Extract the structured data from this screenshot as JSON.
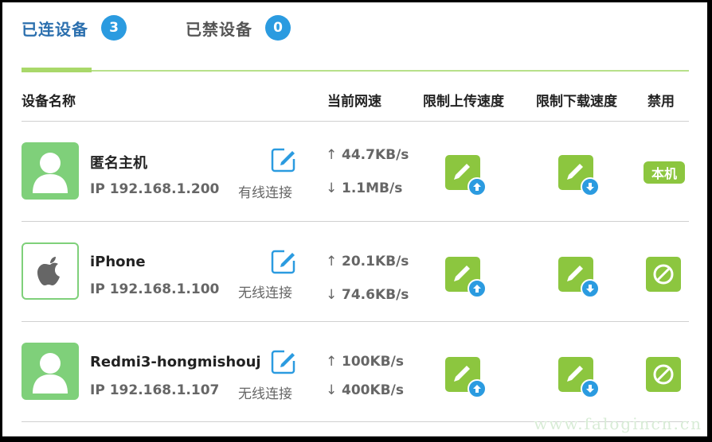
{
  "tabs": [
    {
      "label": "已连设备",
      "count": "3"
    },
    {
      "label": "已禁设备",
      "count": "0"
    }
  ],
  "columns": {
    "name": "设备名称",
    "speed": "当前网速",
    "upload_limit": "限制上传速度",
    "download_limit": "限制下载速度",
    "ban": "禁用"
  },
  "devices": [
    {
      "name": "匿名主机",
      "ip": "IP 192.168.1.200",
      "connection": "有线连接",
      "up": "44.7KB/s",
      "down": "1.1MB/s",
      "avatar": "person-icon",
      "action": "本机"
    },
    {
      "name": "iPhone",
      "ip": "IP 192.168.1.100",
      "connection": "无线连接",
      "up": "20.1KB/s",
      "down": "74.6KB/s",
      "avatar": "apple-icon",
      "action": ""
    },
    {
      "name": "Redmi3-hongmishouj",
      "ip": "IP 192.168.1.107",
      "connection": "无线连接",
      "up": "100KB/s",
      "down": "400KB/s",
      "avatar": "person-icon",
      "action": ""
    }
  ],
  "watermark": "www.falogincn.cn",
  "colors": {
    "accent_green": "#8cc63f",
    "accent_blue": "#2b9be0",
    "tab_active": "#2b6fae"
  }
}
